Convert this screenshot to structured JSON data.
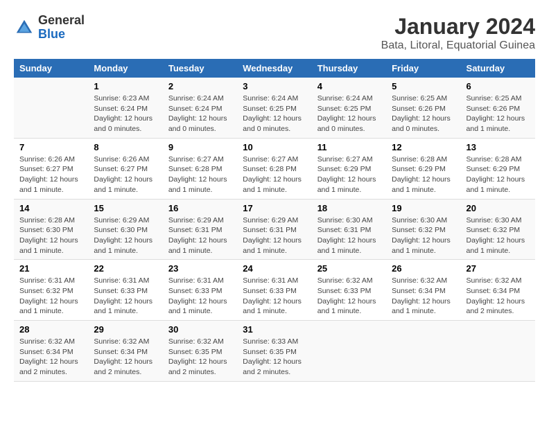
{
  "logo": {
    "general": "General",
    "blue": "Blue"
  },
  "title": "January 2024",
  "subtitle": "Bata, Litoral, Equatorial Guinea",
  "days_of_week": [
    "Sunday",
    "Monday",
    "Tuesday",
    "Wednesday",
    "Thursday",
    "Friday",
    "Saturday"
  ],
  "weeks": [
    [
      {
        "day": "",
        "info": ""
      },
      {
        "day": "1",
        "info": "Sunrise: 6:23 AM\nSunset: 6:24 PM\nDaylight: 12 hours\nand 0 minutes."
      },
      {
        "day": "2",
        "info": "Sunrise: 6:24 AM\nSunset: 6:24 PM\nDaylight: 12 hours\nand 0 minutes."
      },
      {
        "day": "3",
        "info": "Sunrise: 6:24 AM\nSunset: 6:25 PM\nDaylight: 12 hours\nand 0 minutes."
      },
      {
        "day": "4",
        "info": "Sunrise: 6:24 AM\nSunset: 6:25 PM\nDaylight: 12 hours\nand 0 minutes."
      },
      {
        "day": "5",
        "info": "Sunrise: 6:25 AM\nSunset: 6:26 PM\nDaylight: 12 hours\nand 0 minutes."
      },
      {
        "day": "6",
        "info": "Sunrise: 6:25 AM\nSunset: 6:26 PM\nDaylight: 12 hours\nand 1 minute."
      }
    ],
    [
      {
        "day": "7",
        "info": "Sunrise: 6:26 AM\nSunset: 6:27 PM\nDaylight: 12 hours\nand 1 minute."
      },
      {
        "day": "8",
        "info": "Sunrise: 6:26 AM\nSunset: 6:27 PM\nDaylight: 12 hours\nand 1 minute."
      },
      {
        "day": "9",
        "info": "Sunrise: 6:27 AM\nSunset: 6:28 PM\nDaylight: 12 hours\nand 1 minute."
      },
      {
        "day": "10",
        "info": "Sunrise: 6:27 AM\nSunset: 6:28 PM\nDaylight: 12 hours\nand 1 minute."
      },
      {
        "day": "11",
        "info": "Sunrise: 6:27 AM\nSunset: 6:29 PM\nDaylight: 12 hours\nand 1 minute."
      },
      {
        "day": "12",
        "info": "Sunrise: 6:28 AM\nSunset: 6:29 PM\nDaylight: 12 hours\nand 1 minute."
      },
      {
        "day": "13",
        "info": "Sunrise: 6:28 AM\nSunset: 6:29 PM\nDaylight: 12 hours\nand 1 minute."
      }
    ],
    [
      {
        "day": "14",
        "info": "Sunrise: 6:28 AM\nSunset: 6:30 PM\nDaylight: 12 hours\nand 1 minute."
      },
      {
        "day": "15",
        "info": "Sunrise: 6:29 AM\nSunset: 6:30 PM\nDaylight: 12 hours\nand 1 minute."
      },
      {
        "day": "16",
        "info": "Sunrise: 6:29 AM\nSunset: 6:31 PM\nDaylight: 12 hours\nand 1 minute."
      },
      {
        "day": "17",
        "info": "Sunrise: 6:29 AM\nSunset: 6:31 PM\nDaylight: 12 hours\nand 1 minute."
      },
      {
        "day": "18",
        "info": "Sunrise: 6:30 AM\nSunset: 6:31 PM\nDaylight: 12 hours\nand 1 minute."
      },
      {
        "day": "19",
        "info": "Sunrise: 6:30 AM\nSunset: 6:32 PM\nDaylight: 12 hours\nand 1 minute."
      },
      {
        "day": "20",
        "info": "Sunrise: 6:30 AM\nSunset: 6:32 PM\nDaylight: 12 hours\nand 1 minute."
      }
    ],
    [
      {
        "day": "21",
        "info": "Sunrise: 6:31 AM\nSunset: 6:32 PM\nDaylight: 12 hours\nand 1 minute."
      },
      {
        "day": "22",
        "info": "Sunrise: 6:31 AM\nSunset: 6:33 PM\nDaylight: 12 hours\nand 1 minute."
      },
      {
        "day": "23",
        "info": "Sunrise: 6:31 AM\nSunset: 6:33 PM\nDaylight: 12 hours\nand 1 minute."
      },
      {
        "day": "24",
        "info": "Sunrise: 6:31 AM\nSunset: 6:33 PM\nDaylight: 12 hours\nand 1 minute."
      },
      {
        "day": "25",
        "info": "Sunrise: 6:32 AM\nSunset: 6:33 PM\nDaylight: 12 hours\nand 1 minute."
      },
      {
        "day": "26",
        "info": "Sunrise: 6:32 AM\nSunset: 6:34 PM\nDaylight: 12 hours\nand 1 minute."
      },
      {
        "day": "27",
        "info": "Sunrise: 6:32 AM\nSunset: 6:34 PM\nDaylight: 12 hours\nand 2 minutes."
      }
    ],
    [
      {
        "day": "28",
        "info": "Sunrise: 6:32 AM\nSunset: 6:34 PM\nDaylight: 12 hours\nand 2 minutes."
      },
      {
        "day": "29",
        "info": "Sunrise: 6:32 AM\nSunset: 6:34 PM\nDaylight: 12 hours\nand 2 minutes."
      },
      {
        "day": "30",
        "info": "Sunrise: 6:32 AM\nSunset: 6:35 PM\nDaylight: 12 hours\nand 2 minutes."
      },
      {
        "day": "31",
        "info": "Sunrise: 6:33 AM\nSunset: 6:35 PM\nDaylight: 12 hours\nand 2 minutes."
      },
      {
        "day": "",
        "info": ""
      },
      {
        "day": "",
        "info": ""
      },
      {
        "day": "",
        "info": ""
      }
    ]
  ]
}
